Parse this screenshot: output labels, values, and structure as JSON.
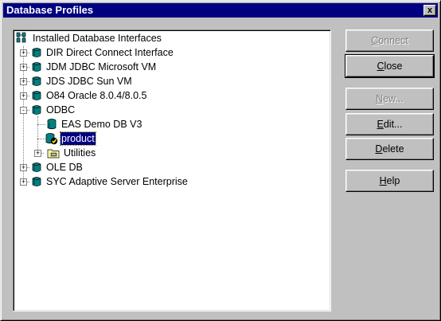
{
  "window": {
    "title": "Database Profiles",
    "close_glyph": "x"
  },
  "tree": {
    "root": {
      "label": "Installed Database Interfaces",
      "icon": "database-interfaces-icon"
    },
    "items": [
      {
        "label": "DIR Direct Connect Interface",
        "expander": "+",
        "icon": "database-driver-icon"
      },
      {
        "label": "JDM JDBC Microsoft VM",
        "expander": "+",
        "icon": "database-driver-icon"
      },
      {
        "label": "JDS JDBC Sun VM",
        "expander": "+",
        "icon": "database-driver-icon"
      },
      {
        "label": "O84 Oracle 8.0.4/8.0.5",
        "expander": "+",
        "icon": "database-driver-icon"
      },
      {
        "label": "ODBC",
        "expander": "-",
        "icon": "database-driver-icon",
        "children": [
          {
            "label": "EAS Demo DB V3",
            "icon": "database-profile-icon"
          },
          {
            "label": "product",
            "icon": "connected-profile-icon",
            "selected": true
          },
          {
            "label": "Utilities",
            "expander": "+",
            "icon": "utilities-folder-icon"
          }
        ]
      },
      {
        "label": "OLE DB",
        "expander": "+",
        "icon": "database-driver-icon"
      },
      {
        "label": "SYC Adaptive Server Enterprise",
        "expander": "+",
        "icon": "database-driver-icon"
      }
    ]
  },
  "buttons": {
    "connect": {
      "pre": "",
      "accel": "C",
      "post": "onnect",
      "enabled": false
    },
    "close": {
      "pre": "",
      "accel": "C",
      "post": "lose",
      "enabled": true,
      "default": true
    },
    "new": {
      "pre": "",
      "accel": "N",
      "post": "ew...",
      "enabled": false
    },
    "edit": {
      "pre": "",
      "accel": "E",
      "post": "dit...",
      "enabled": true
    },
    "delete": {
      "pre": "",
      "accel": "D",
      "post": "elete",
      "enabled": true
    },
    "help": {
      "pre": "",
      "accel": "H",
      "post": "elp",
      "enabled": true
    }
  },
  "colors": {
    "titlebar": "#000080",
    "dialog_face": "#c0c0c0",
    "selection": "#000080"
  }
}
